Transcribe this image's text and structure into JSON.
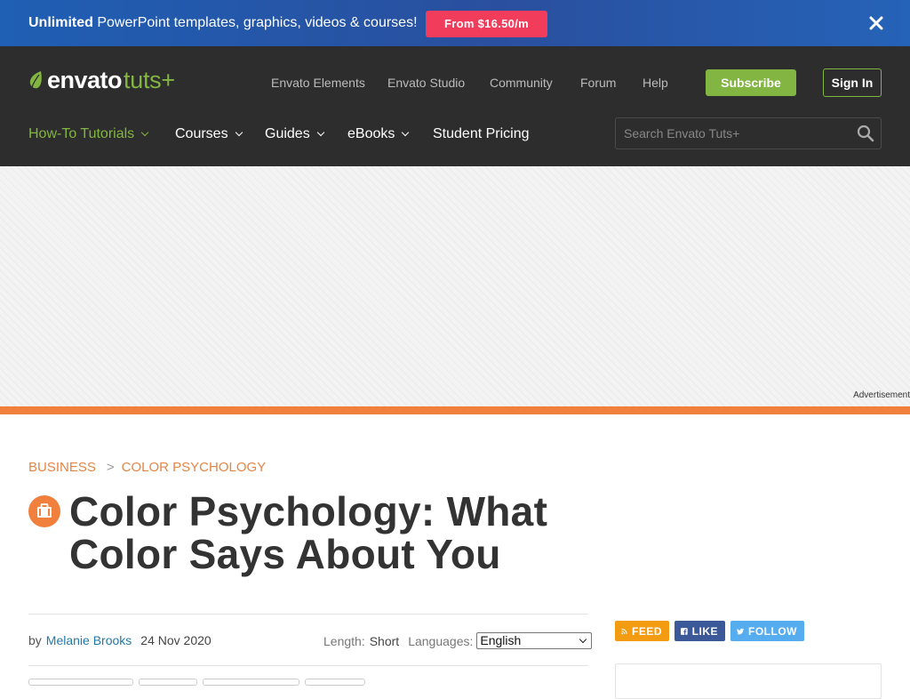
{
  "promo": {
    "strong": "Unlimited",
    "text": " PowerPoint templates, graphics, videos & courses!",
    "cta": "From $16.50/m"
  },
  "header": {
    "logo_primary": "envato",
    "logo_secondary": "tuts+",
    "top_links": [
      "Envato Elements",
      "Envato Studio",
      "Community",
      "Forum",
      "Help"
    ],
    "subscribe": "Subscribe",
    "sign_in": "Sign In",
    "nav": [
      {
        "label": "How-To Tutorials",
        "has_menu": true,
        "active": true
      },
      {
        "label": "Courses",
        "has_menu": true
      },
      {
        "label": "Guides",
        "has_menu": true
      },
      {
        "label": "eBooks",
        "has_menu": true
      },
      {
        "label": "Student Pricing",
        "has_menu": false
      }
    ],
    "search_placeholder": "Search Envato Tuts+"
  },
  "ad": {
    "label": "Advertisement"
  },
  "article": {
    "breadcrumb": [
      "BUSINESS",
      "COLOR PSYCHOLOGY"
    ],
    "breadcrumb_sep": ">",
    "title": "Color Psychology: What Color Says About You",
    "by": "by",
    "author": "Melanie Brooks",
    "date": "24 Nov 2020",
    "length_label": "Length:",
    "length_value": "Short",
    "languages_label": "Languages:",
    "language_selected": "English"
  },
  "social": {
    "feed": "FEED",
    "like": "LIKE",
    "follow": "FOLLOW"
  },
  "colors": {
    "brand_green": "#82b541",
    "accent_orange": "#f0803c",
    "promo_pink": "#f23c5b",
    "header_bg": "#2d2d2d"
  }
}
